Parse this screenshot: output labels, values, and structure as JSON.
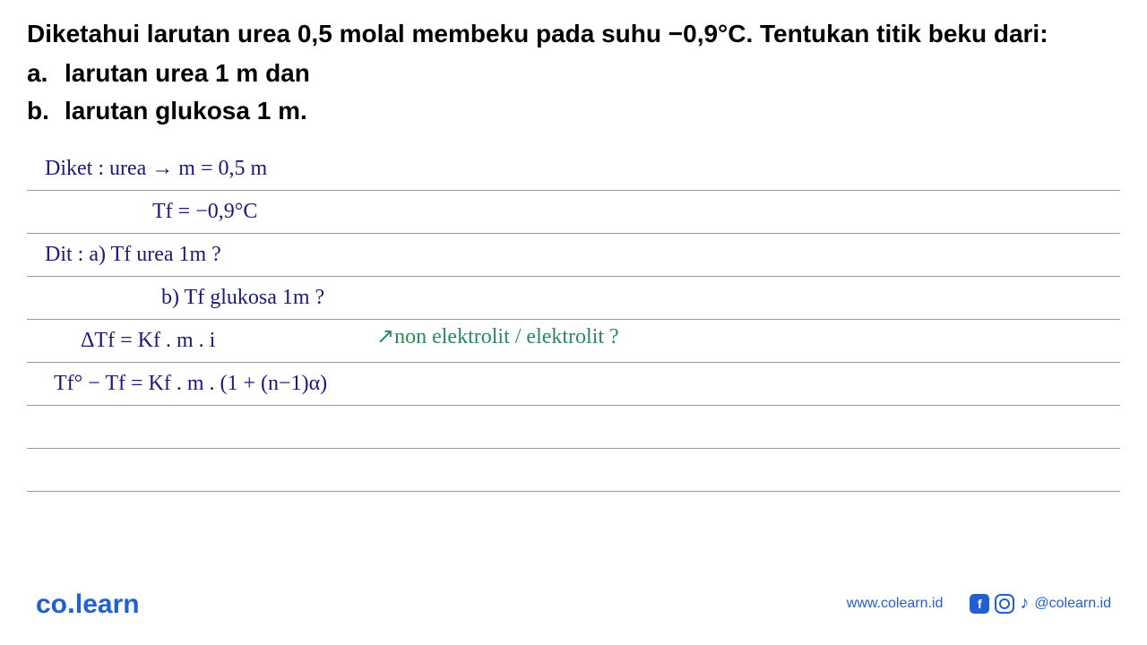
{
  "question": {
    "main": "Diketahui larutan urea 0,5 molal membeku pada suhu −0,9°C. Tentukan titik beku dari:",
    "a_letter": "a.",
    "a_text": "larutan urea 1 m dan",
    "b_letter": "b.",
    "b_text": "larutan glukosa 1 m."
  },
  "handwriting": {
    "line1": "Diket : urea → m = 0,5 m",
    "line2": "Tf = −0,9°C",
    "line3": "Dit :  a) Tf urea 1m ?",
    "line4": "b) Tf glukosa 1m ?",
    "line5": "ΔTf = Kf . m . i",
    "line5_annotation": "↗non elektrolit / elektrolit ?",
    "line6": "Tf° − Tf = Kf . m . (1 + (n−1)α)"
  },
  "footer": {
    "logo_co": "co",
    "logo_learn": "learn",
    "website": "www.colearn.id",
    "handle": "@colearn.id"
  }
}
